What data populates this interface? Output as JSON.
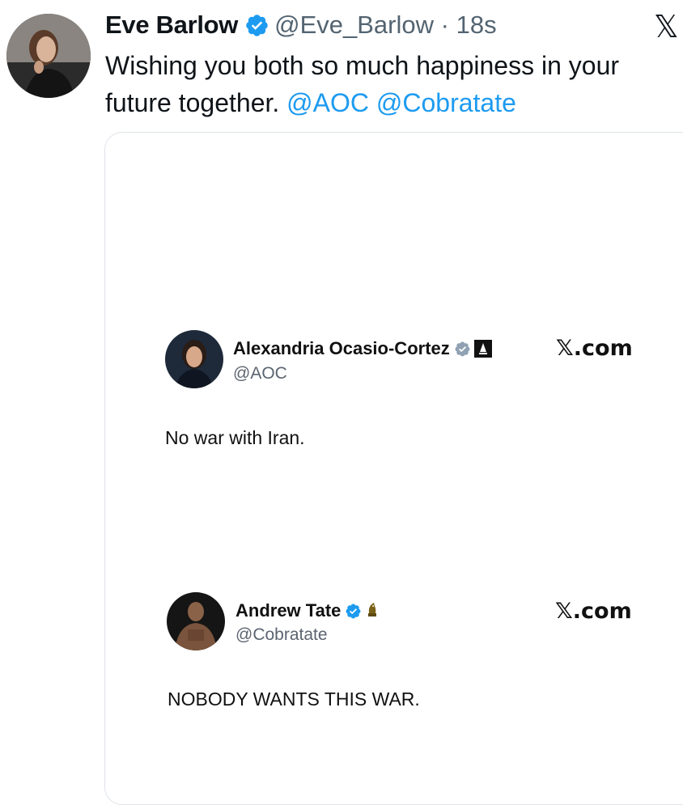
{
  "header": {
    "display_name": "Eve Barlow",
    "handle": "@Eve_Barlow",
    "separator": "·",
    "time": "18s",
    "platform_logo": "𝕏"
  },
  "tweet": {
    "text_prefix": "Wishing you both so much happiness in your future together.",
    "mentions": [
      "@AOC",
      "@Cobratate"
    ]
  },
  "quoted": [
    {
      "display_name": "Alexandria Ocasio-Cortez",
      "handle": "@AOC",
      "site": "𝕏.com",
      "text": "No war with Iran.",
      "badges": [
        "verified-badge-icon",
        "affiliate-badge-icon"
      ]
    },
    {
      "display_name": "Andrew Tate",
      "handle": "@Cobratate",
      "site": "𝕏.com",
      "text": "NOBODY WANTS THIS WAR.",
      "badges": [
        "verified-badge-icon",
        "coin-badge-icon"
      ]
    }
  ],
  "colors": {
    "link": "#1d9bf0",
    "verified": "#1d9bf0",
    "secondary_text": "#536471"
  }
}
